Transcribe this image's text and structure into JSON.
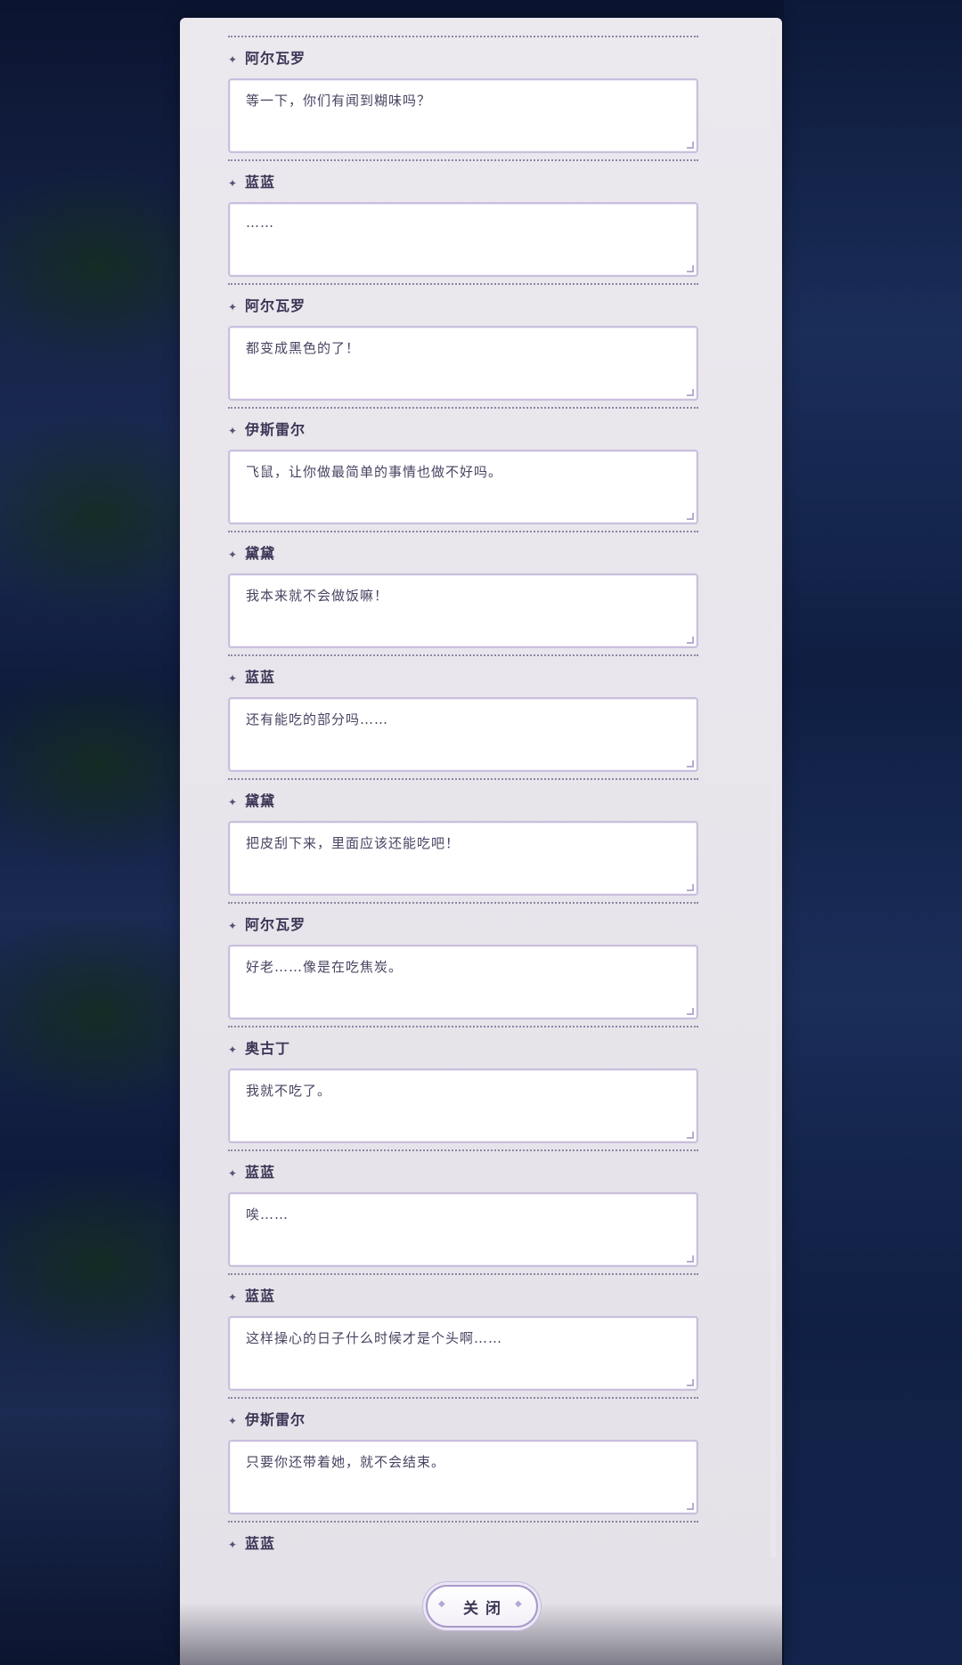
{
  "log": {
    "entries": [
      {
        "speaker": "阿尔瓦罗",
        "text": "等一下，你们有闻到糊味吗？"
      },
      {
        "speaker": "蓝蓝",
        "text": "……"
      },
      {
        "speaker": "阿尔瓦罗",
        "text": "都变成黑色的了！"
      },
      {
        "speaker": "伊斯雷尔",
        "text": "飞鼠，让你做最简单的事情也做不好吗。"
      },
      {
        "speaker": "黛黛",
        "text": "我本来就不会做饭嘛！"
      },
      {
        "speaker": "蓝蓝",
        "text": "还有能吃的部分吗……"
      },
      {
        "speaker": "黛黛",
        "text": "把皮刮下来，里面应该还能吃吧！"
      },
      {
        "speaker": "阿尔瓦罗",
        "text": "好老……像是在吃焦炭。"
      },
      {
        "speaker": "奥古丁",
        "text": "我就不吃了。"
      },
      {
        "speaker": "蓝蓝",
        "text": "唉……"
      },
      {
        "speaker": "蓝蓝",
        "text": "这样操心的日子什么时候才是个头啊……"
      },
      {
        "speaker": "伊斯雷尔",
        "text": "只要你还带着她，就不会结束。"
      }
    ],
    "last_speaker": "蓝蓝"
  },
  "close_button": {
    "label": "关闭"
  },
  "icons": {
    "speaker_marker": "sparkle-icon",
    "button_deco": "diamond-icon"
  },
  "colors": {
    "panel": "#e8e5ec",
    "bubble_border": "#c9bfdd",
    "text": "#4a4362",
    "name": "#3c3656"
  }
}
